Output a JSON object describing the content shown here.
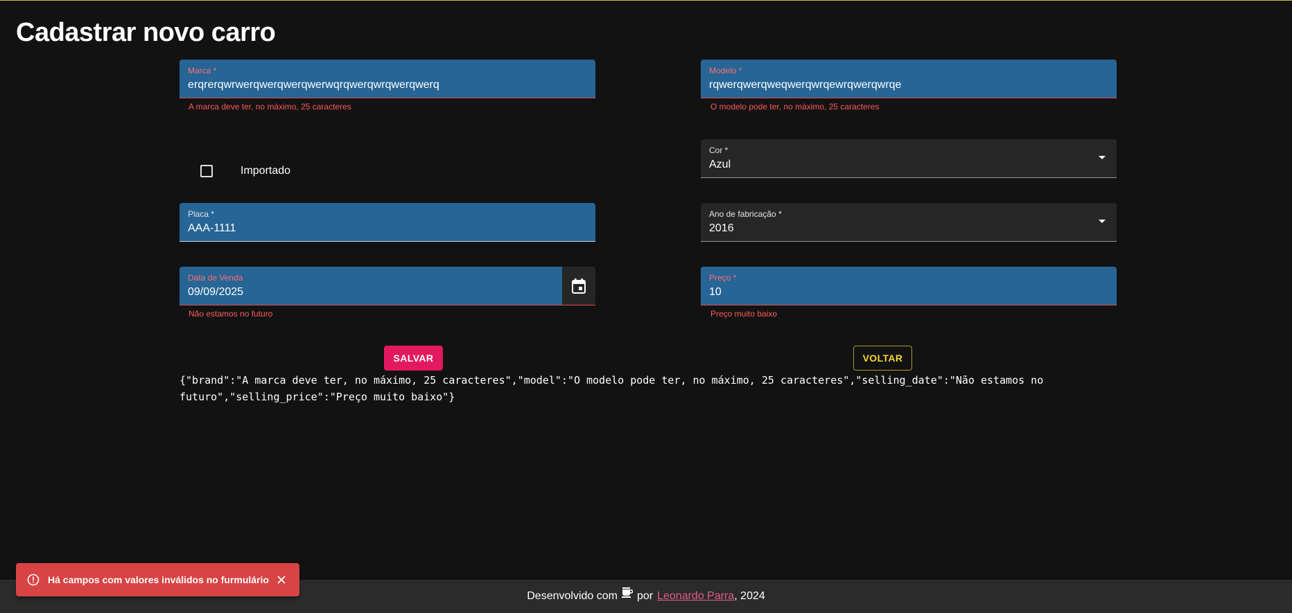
{
  "page": {
    "title": "Cadastrar novo carro"
  },
  "form": {
    "brand": {
      "label": "Marca *",
      "value": "erqrerqwrwerqwerqwerqwerwqrqwerqwrqwerqwerq",
      "error": "A marca deve ter, no máximo, 25 caracteres"
    },
    "model": {
      "label": "Modelo *",
      "value": "rqwerqwerqweqwerqwrqewrqwerqwrqe",
      "error": "O modelo pode ter, no máximo, 25 caracteres"
    },
    "imported": {
      "label": "Importado",
      "checked": false
    },
    "color": {
      "label": "Cor *",
      "value": "Azul"
    },
    "plate": {
      "label": "Placa *",
      "value": "AAA-1111"
    },
    "year": {
      "label": "Ano de fabricação *",
      "value": "2016"
    },
    "selling_date": {
      "label": "Data de Venda",
      "value": "09/09/2025",
      "error": "Não estamos no futuro"
    },
    "price": {
      "label": "Preço *",
      "value": "10",
      "error": "Preço muito baixo"
    }
  },
  "buttons": {
    "save": "SALVAR",
    "back": "VOLTAR"
  },
  "errors_json": "{\"brand\":\"A marca deve ter, no máximo, 25 caracteres\",\"model\":\"O modelo pode ter, no máximo, 25 caracteres\",\"selling_date\":\"Não estamos no futuro\",\"selling_price\":\"Preço muito baixo\"}",
  "toast": {
    "message": "Há campos com valores inválidos no furmulário"
  },
  "footer": {
    "prefix": "Desenvolvido com",
    "by": "por",
    "author": "Leonardo Parra",
    "suffix": ", 2024"
  },
  "icons": {
    "calendar": "calendar-icon",
    "coffee": "coffee-icon",
    "alert": "alert-circle-icon",
    "close": "close-icon",
    "dropdown": "caret-down-icon"
  },
  "colors": {
    "background": "#121212",
    "field_filled": "#266595",
    "error": "#ff5a5a",
    "save": "#e3195f",
    "back": "#f5d634",
    "toast": "#d84343",
    "link": "#e35a8d"
  }
}
